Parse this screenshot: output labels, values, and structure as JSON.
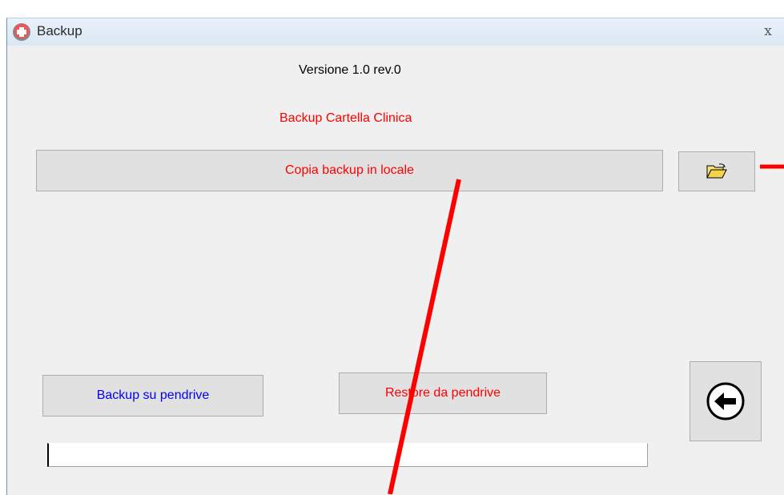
{
  "window": {
    "title": "Backup",
    "close_label": "x"
  },
  "header": {
    "version": "Versione 1.0 rev.0",
    "section_title": "Backup Cartella Clinica"
  },
  "buttons": {
    "copy_local": "Copia backup in locale",
    "backup_pendrive": "Backup su pendrive",
    "restore_pendrive": "Restore da pendrive"
  },
  "icons": {
    "app": "app-cross-icon",
    "folder": "open-folder-icon",
    "back": "back-arrow-icon"
  },
  "colors": {
    "red_text": "#ff0000",
    "blue_text": "#0000ff",
    "annotation": "#ff0000"
  }
}
